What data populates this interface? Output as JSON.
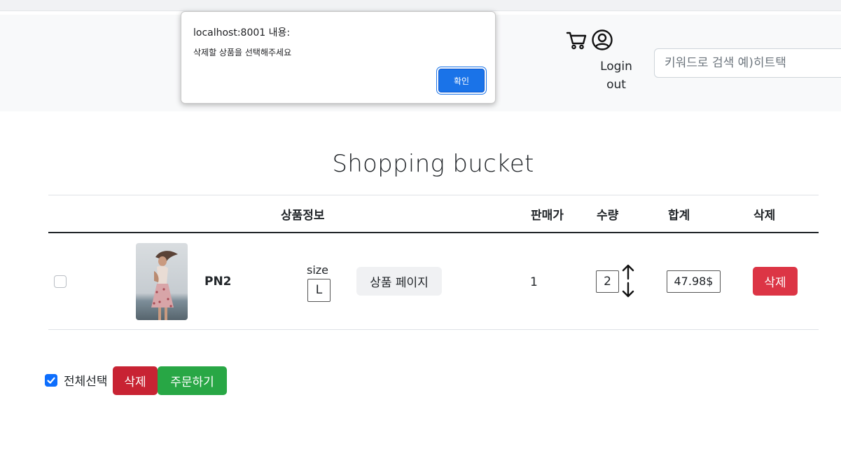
{
  "navbar": {
    "icons": {
      "cart": "cart-icon",
      "user": "user-circle-icon"
    },
    "login_line1": "Login",
    "login_line2": "out",
    "search_placeholder": "키워드로 검색 예)히트택"
  },
  "dialog": {
    "title": "localhost:8001 내용:",
    "message": "삭제할 상품을 선택해주세요",
    "ok_label": "확인",
    "accent": "#1a73e8"
  },
  "page": {
    "title": "Shopping bucket"
  },
  "table": {
    "headers": {
      "product_info": "상품정보",
      "price": "판매가",
      "quantity": "수량",
      "total": "합계",
      "delete": "삭제"
    },
    "rows": [
      {
        "checked": false,
        "product_name": "PN2",
        "size_label": "size",
        "size_value": "L",
        "page_button": "상품 페이지",
        "price": "1",
        "quantity": "2",
        "total": "47.98$",
        "delete_label": "삭제"
      }
    ]
  },
  "footer": {
    "select_all_checked": true,
    "select_all_label": "전체선택",
    "delete_label": "삭제",
    "order_label": "주문하기",
    "colors": {
      "danger": "#dc3545",
      "success": "#28a745",
      "primary": "#0d6efd"
    }
  }
}
